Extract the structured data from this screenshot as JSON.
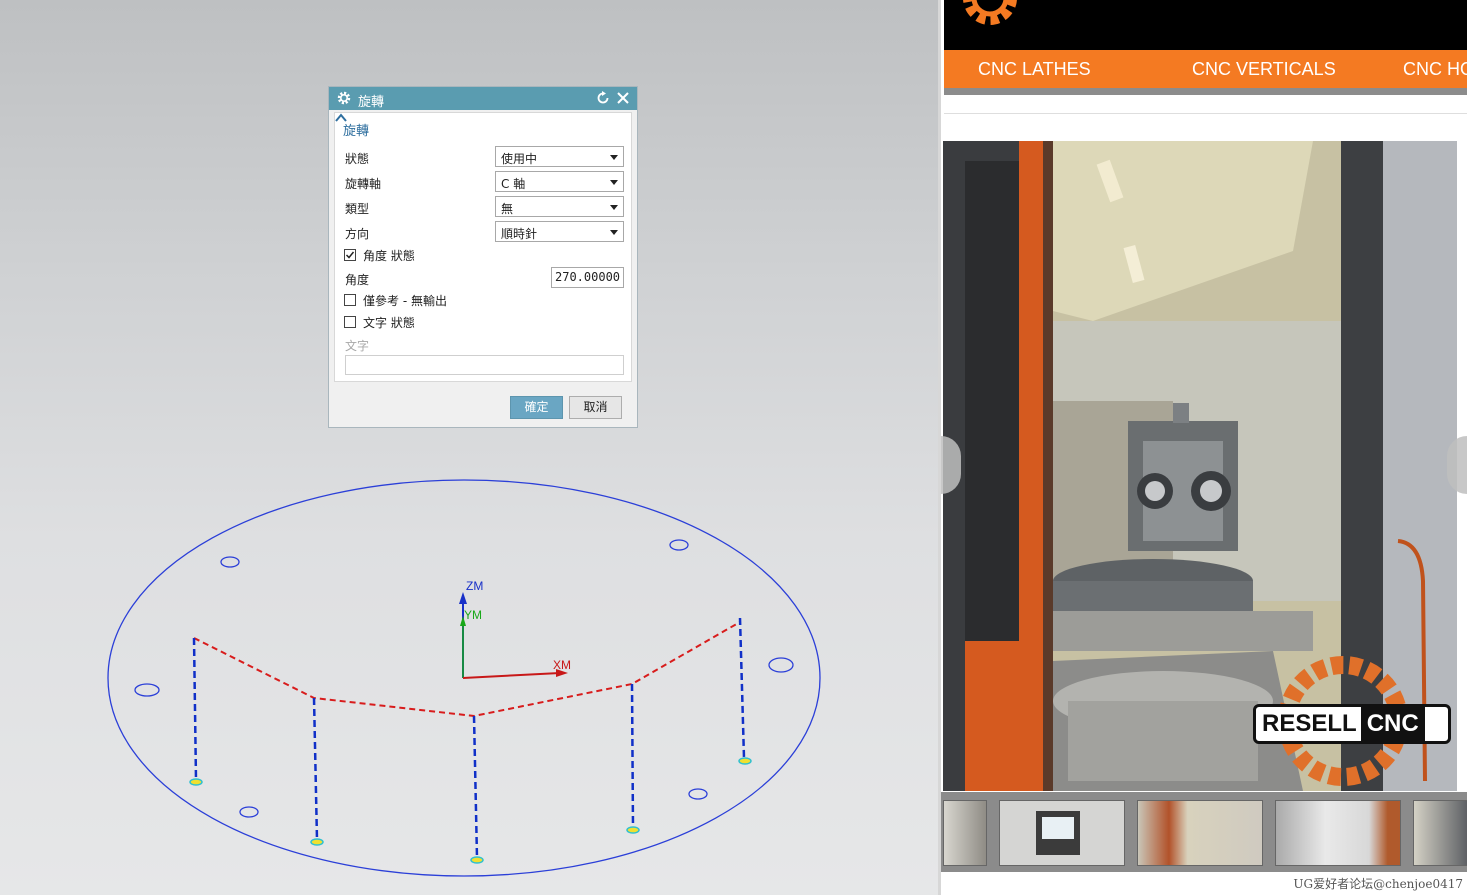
{
  "dialog": {
    "title": "旋轉",
    "group_title": "旋轉",
    "fields": [
      {
        "label": "狀態",
        "value": "使用中"
      },
      {
        "label": "旋轉軸",
        "value": "C 軸"
      },
      {
        "label": "類型",
        "value": "無"
      },
      {
        "label": "方向",
        "value": "順時針"
      }
    ],
    "angle_state_label": "角度 狀態",
    "angle_state_checked": true,
    "angle_label": "角度",
    "angle_value": "270.00000",
    "ref_only_label": "僅參考 - 無輸出",
    "ref_only_checked": false,
    "text_state_label": "文字 狀態",
    "text_state_checked": false,
    "text_label": "文字",
    "text_value": "",
    "ok_label": "確定",
    "cancel_label": "取消"
  },
  "cad_view": {
    "axis_labels": {
      "z": "ZM",
      "y": "YM",
      "x": "XM"
    },
    "colors": {
      "outline": "#2b3fd8",
      "toolpath_cut": "#d81c1c",
      "toolpath_plunge": "#1030c8",
      "axis_x": "#c81818",
      "axis_y": "#18a818",
      "axis_z": "#1830c8"
    }
  },
  "website": {
    "nav_items": [
      "CNC LATHES",
      "CNC VERTICALS",
      "CNC HO"
    ],
    "brand_left": "RESELL",
    "brand_right": "CNC",
    "accent_color": "#f47a22"
  },
  "watermark": "UG爱好者论坛@chenjoe0417"
}
